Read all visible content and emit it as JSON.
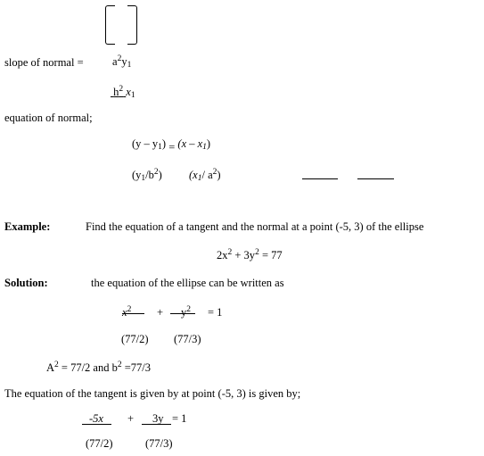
{
  "slope": {
    "label": "slope of normal =",
    "numerator": {
      "base": "a",
      "sup": "2",
      "var": "y",
      "sub": "1"
    },
    "denominator": {
      "base": "h",
      "sup": "2",
      "var": "x",
      "sub": "1"
    }
  },
  "normal": {
    "label": "equation of normal;",
    "line1_left": "(y – y",
    "line1_left_sub": "1",
    "line1_left_close": ")",
    "line1_eq": "=",
    "line1_right": "(x – x",
    "line1_right_sub": "1",
    "line1_right_close": ")",
    "line2_left_open": "(y",
    "line2_left_sub": "1",
    "line2_left_mid": "/b",
    "line2_left_sup": "2",
    "line2_left_close": ")",
    "line2_right_open": "(x",
    "line2_right_sub": "1",
    "line2_right_mid": "/ a",
    "line2_right_sup": "2",
    "line2_right_close": ")"
  },
  "example": {
    "label": "Example:",
    "text": "Find the equation of a tangent and the normal at a point (-5, 3) of the ellipse",
    "eq_part1": "2x",
    "eq_sup1": "2",
    "eq_part2": " + 3y",
    "eq_sup2": "2",
    "eq_part3": " = 77"
  },
  "solution": {
    "label": "Solution:",
    "text": "the equation of the ellipse can be written as",
    "frac1_num": "x",
    "frac1_sup": "2",
    "plus": "+",
    "frac2_num": "y",
    "frac2_sup": "2",
    "equals_one": "= 1",
    "frac1_den": "(77/2)",
    "frac2_den": "(77/3)",
    "ab_line_a": "A",
    "ab_sup_a": "2",
    "ab_mid": " = 77/2 and b",
    "ab_sup_b": "2",
    "ab_end": " =77/3",
    "tangent_text": "The equation of the tangent is given by at point (-5, 3) is given by;",
    "t_num1": "-5x",
    "t_plus": "+",
    "t_num2": "3y",
    "t_eq": "=  1",
    "t_den1": "(77/2)",
    "t_den2": "(77/3)"
  }
}
